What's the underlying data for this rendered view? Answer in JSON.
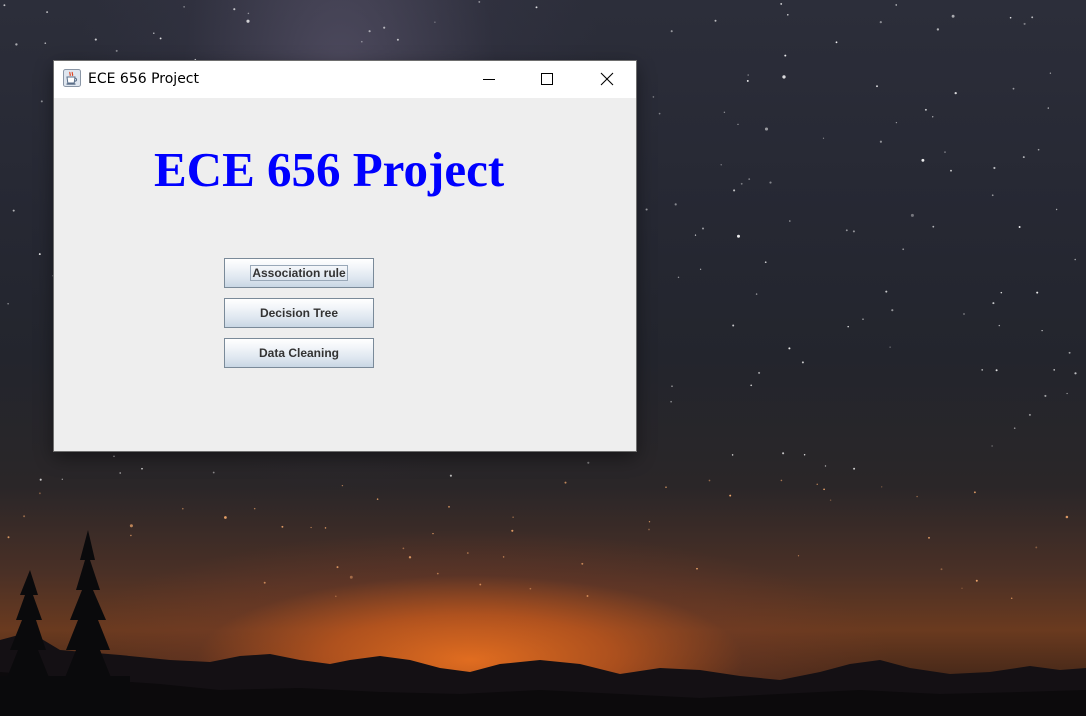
{
  "window": {
    "title": "ECE 656 Project",
    "icon": "java-coffee-cup-icon"
  },
  "title_controls": {
    "minimize_icon": "minimize-icon",
    "maximize_icon": "maximize-icon",
    "close_icon": "close-icon"
  },
  "content": {
    "heading": "ECE 656 Project",
    "heading_color": "#0000ff"
  },
  "buttons": [
    {
      "label": "Association rule",
      "focused": true
    },
    {
      "label": "Decision Tree",
      "focused": false
    },
    {
      "label": "Data Cleaning",
      "focused": false
    }
  ],
  "colors": {
    "window_bg": "#eeeeee",
    "titlebar_bg": "#ffffff",
    "button_text": "#333333"
  }
}
